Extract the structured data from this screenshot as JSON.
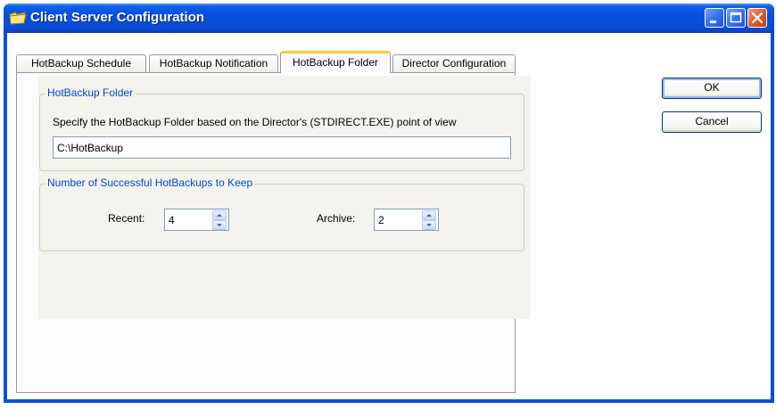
{
  "window": {
    "title": "Client Server Configuration",
    "icon": "folder-icon"
  },
  "tabs": [
    {
      "label": "HotBackup Schedule",
      "active": false
    },
    {
      "label": "HotBackup Notification",
      "active": false
    },
    {
      "label": "HotBackup Folder",
      "active": true
    },
    {
      "label": "Director Configuration",
      "active": false
    }
  ],
  "folder_group": {
    "title": "HotBackup Folder",
    "description": "Specify the HotBackup Folder based on the Director's (STDIRECT.EXE) point of view",
    "path_value": "C:\\HotBackup"
  },
  "keep_group": {
    "title": "Number of Successful HotBackups to Keep",
    "recent_label": "Recent:",
    "recent_value": "4",
    "archive_label": "Archive:",
    "archive_value": "2"
  },
  "buttons": {
    "ok_label": "OK",
    "cancel_label": "Cancel"
  },
  "colors": {
    "titlebar": "#0A4FD7",
    "group_title": "#0046D5",
    "active_tab_highlight": "#FFC83C"
  }
}
